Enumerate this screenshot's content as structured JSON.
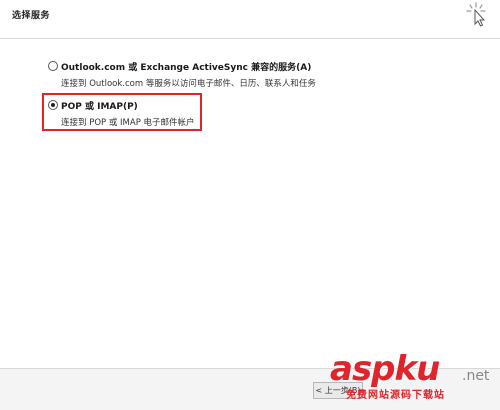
{
  "header": {
    "title": "选择服务"
  },
  "options": [
    {
      "label": "Outlook.com 或 Exchange ActiveSync 兼容的服务(A)",
      "description": "连接到 Outlook.com 等服务以访问电子邮件、日历、联系人和任务",
      "selected": false
    },
    {
      "label": "POP 或 IMAP(P)",
      "description": "连接到 POP 或 IMAP 电子邮件帐户",
      "selected": true
    }
  ],
  "footer": {
    "back_label": "< 上一步(B)"
  },
  "watermark": {
    "main": "aspku",
    "suffix": ".net",
    "sub": "免费网站源码下载站"
  },
  "colors": {
    "highlight": "#e0242b",
    "divider": "#d9d9d9",
    "footer_bg": "#f4f4f4"
  },
  "icons": {
    "cursor": "busy-cursor-icon"
  }
}
